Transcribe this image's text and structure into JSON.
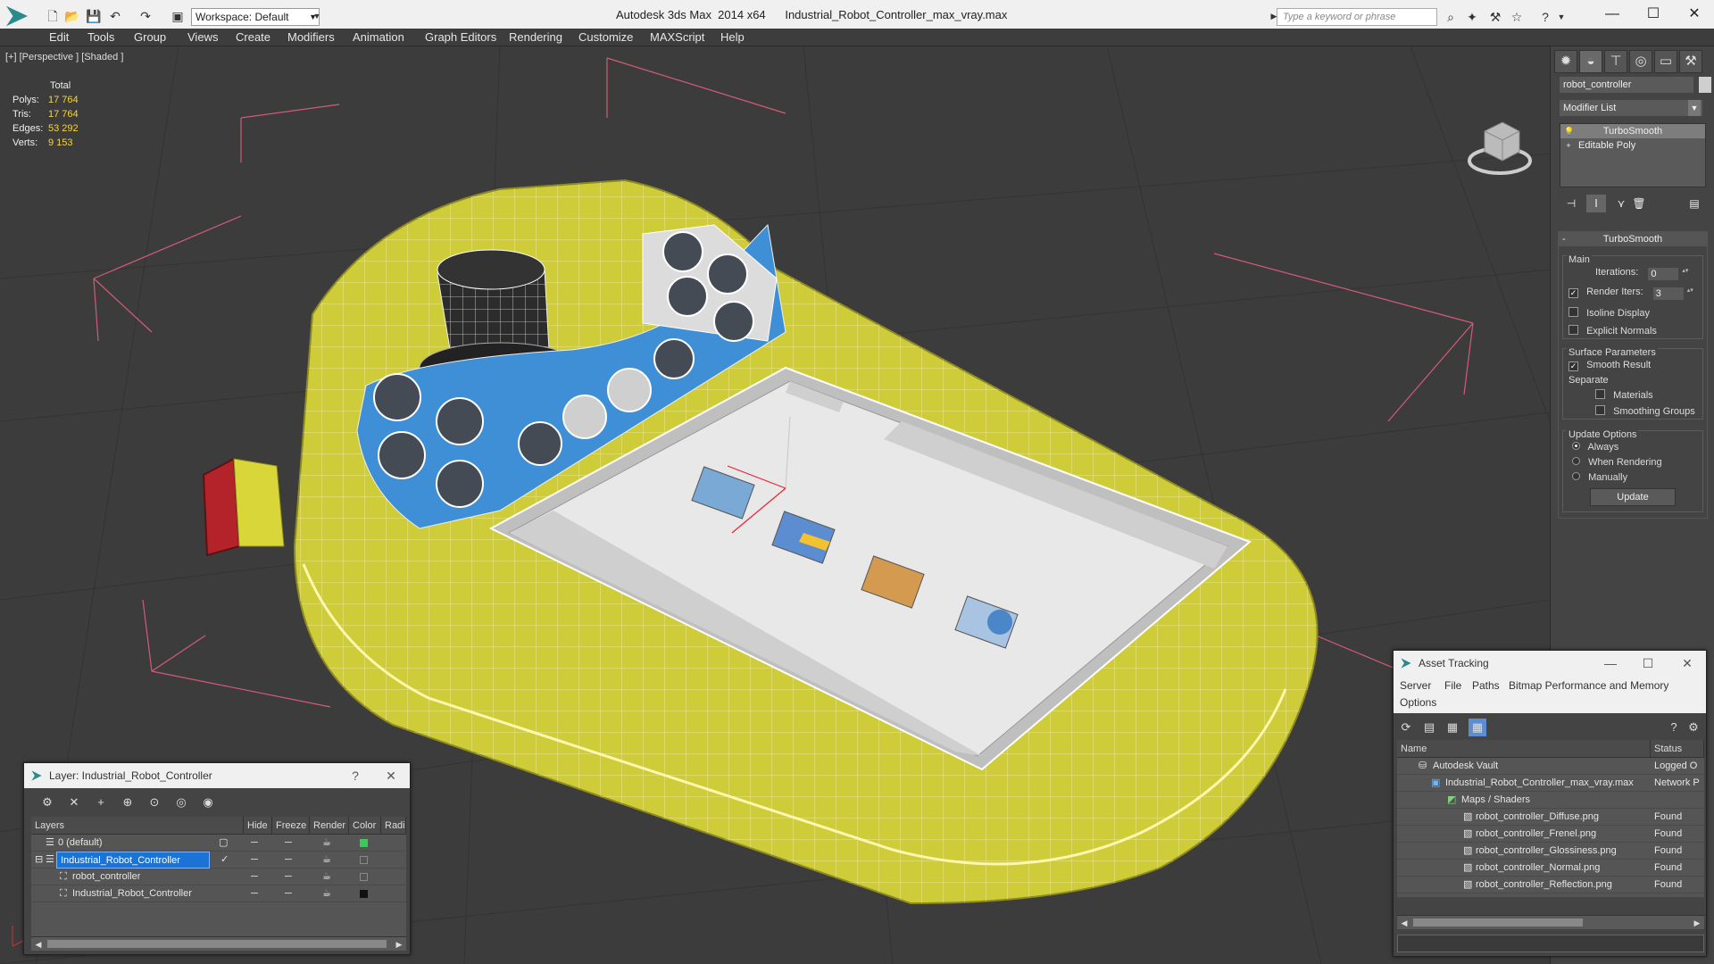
{
  "titlebar": {
    "workspace": "Workspace: Default",
    "title": "Autodesk 3ds Max  2014 x64      Industrial_Robot_Controller_max_vray.max",
    "search_placeholder": "Type a keyword or phrase"
  },
  "menu": [
    "Edit",
    "Tools",
    "Group",
    "Views",
    "Create",
    "Modifiers",
    "Animation",
    "Graph Editors",
    "Rendering",
    "Customize",
    "MAXScript",
    "Help"
  ],
  "viewport": {
    "label": "[+] [Perspective ] [Shaded ]",
    "stats": {
      "header": "Total",
      "polys_label": "Polys:",
      "polys": "17 764",
      "tris_label": "Tris:",
      "tris": "17 764",
      "edges_label": "Edges:",
      "edges": "53 292",
      "verts_label": "Verts:",
      "verts": "9 153"
    }
  },
  "command_panel": {
    "object_name": "robot_controller",
    "modifier_list": "Modifier List",
    "stack": [
      "TurboSmooth",
      "Editable Poly"
    ],
    "rollout_title": "TurboSmooth",
    "main_group": "Main",
    "iterations_label": "Iterations:",
    "iterations": "0",
    "render_iters_label": "Render Iters:",
    "render_iters": "3",
    "isoline": "Isoline Display",
    "explicit_normals": "Explicit Normals",
    "surface_group": "Surface Parameters",
    "smooth_result": "Smooth Result",
    "separate": "Separate",
    "materials": "Materials",
    "smoothing_groups": "Smoothing Groups",
    "update_group": "Update Options",
    "always": "Always",
    "when_rendering": "When Rendering",
    "manually": "Manually",
    "update_button": "Update"
  },
  "layer_window": {
    "title": "Layer: Industrial_Robot_Controller",
    "help": "?",
    "columns": [
      "Layers",
      "Hide",
      "Freeze",
      "Render",
      "Color",
      "Radio"
    ],
    "rows": [
      {
        "name": "0 (default)",
        "color": "#3cc85a",
        "indent": 0
      },
      {
        "name": "Industrial_Robot_Controller",
        "color": "#333333",
        "indent": 0,
        "selected": true
      },
      {
        "name": "robot_controller",
        "color": "#333333",
        "indent": 1
      },
      {
        "name": "Industrial_Robot_Controller",
        "color": "#111111",
        "indent": 1
      }
    ]
  },
  "asset_window": {
    "title": "Asset Tracking",
    "menu": [
      "Server",
      "File",
      "Paths",
      "Bitmap Performance and Memory",
      "Options"
    ],
    "columns": [
      "Name",
      "Status"
    ],
    "rows": [
      {
        "name": "Autodesk Vault",
        "status": "Logged O",
        "indent": 1
      },
      {
        "name": "Industrial_Robot_Controller_max_vray.max",
        "status": "Network P",
        "indent": 2
      },
      {
        "name": "Maps / Shaders",
        "status": "",
        "indent": 3
      },
      {
        "name": "robot_controller_Diffuse.png",
        "status": "Found",
        "indent": 4
      },
      {
        "name": "robot_controller_Frenel.png",
        "status": "Found",
        "indent": 4
      },
      {
        "name": "robot_controller_Glossiness.png",
        "status": "Found",
        "indent": 4
      },
      {
        "name": "robot_controller_Normal.png",
        "status": "Found",
        "indent": 4
      },
      {
        "name": "robot_controller_Reflection.png",
        "status": "Found",
        "indent": 4
      }
    ]
  },
  "colors": {
    "accent": "#1b73d5",
    "stats": "#f5d442",
    "model_yellow": "#d9d63a",
    "screen_blue": "#3f8fd6",
    "knob_red": "#b4232a"
  }
}
